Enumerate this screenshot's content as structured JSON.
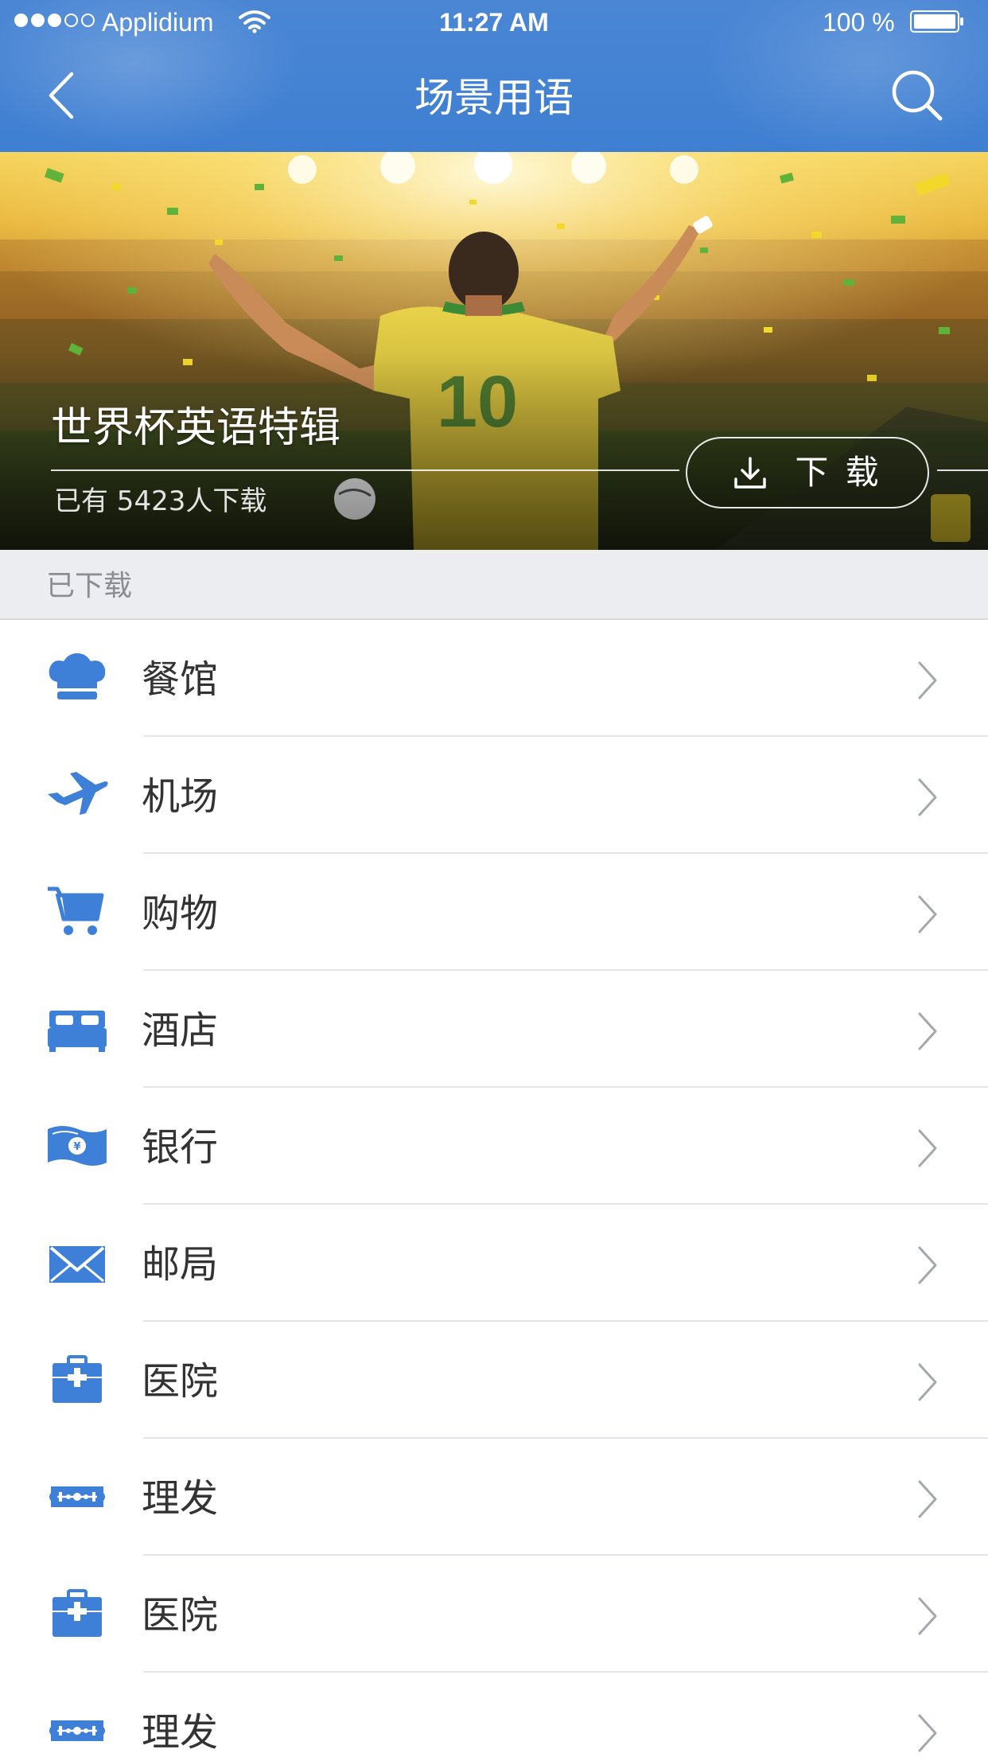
{
  "status_bar": {
    "carrier": "Applidium",
    "time": "11:27 AM",
    "battery": "100 %",
    "signal_bars": 3,
    "signal_total": 5
  },
  "nav": {
    "title": "场景用语",
    "back_icon": "chevron-left-icon",
    "search_icon": "search-icon"
  },
  "banner": {
    "title": "世界杯英语特辑",
    "subtitle": "已有 5423人下载",
    "download_label": "下 载",
    "download_icon": "download-icon"
  },
  "section": {
    "title": "已下载"
  },
  "colors": {
    "accent": "#4a86d4",
    "icon": "#3e7fd8",
    "text": "#333333",
    "chevron": "#a4a7ac"
  },
  "list": [
    {
      "label": "餐馆",
      "icon": "chef-hat-icon"
    },
    {
      "label": "机场",
      "icon": "airplane-icon"
    },
    {
      "label": "购物",
      "icon": "shopping-cart-icon"
    },
    {
      "label": "酒店",
      "icon": "bed-icon"
    },
    {
      "label": "银行",
      "icon": "banknote-icon"
    },
    {
      "label": "邮局",
      "icon": "envelope-icon"
    },
    {
      "label": "医院",
      "icon": "medical-kit-icon"
    },
    {
      "label": "理发",
      "icon": "razor-blade-icon"
    },
    {
      "label": "医院",
      "icon": "medical-kit-icon"
    },
    {
      "label": "理发",
      "icon": "razor-blade-icon"
    }
  ]
}
